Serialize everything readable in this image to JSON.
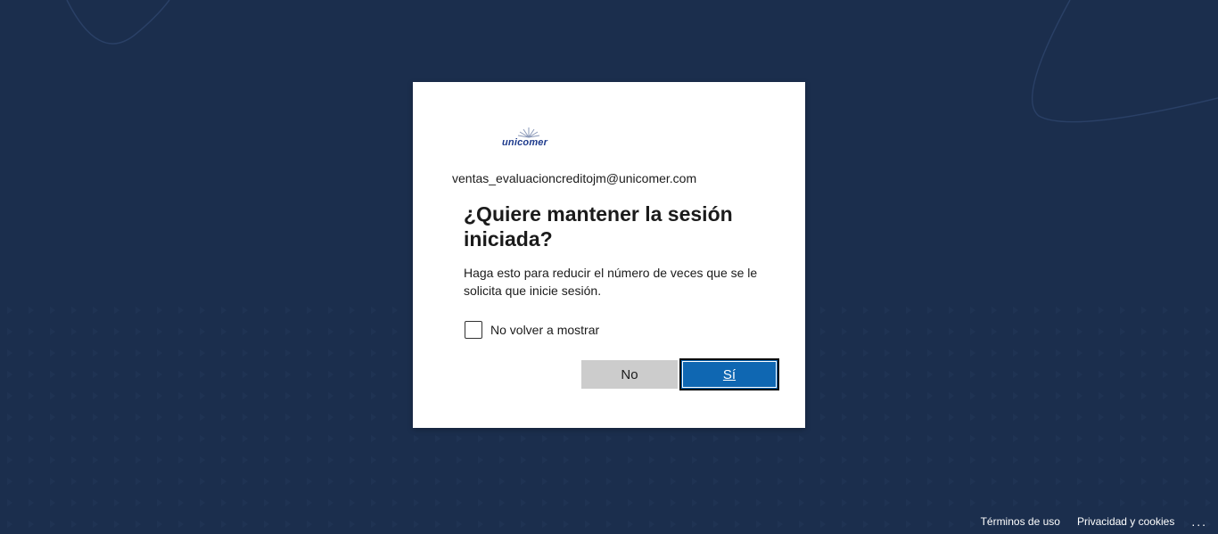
{
  "background": {
    "color": "#1b2e4d"
  },
  "dialog": {
    "logo_text": "unicomer",
    "identity": "ventas_evaluacioncreditojm@unicomer.com",
    "title": "¿Quiere mantener la sesión iniciada?",
    "description": "Haga esto para reducir el número de veces que se le solicita que inicie sesión.",
    "checkbox_label": "No volver a mostrar",
    "checkbox_checked": false,
    "no_button": "No",
    "yes_button": "Sí",
    "accent_color": "#0f67b2"
  },
  "footer": {
    "terms": "Términos de uso",
    "privacy": "Privacidad y cookies",
    "more": "..."
  }
}
